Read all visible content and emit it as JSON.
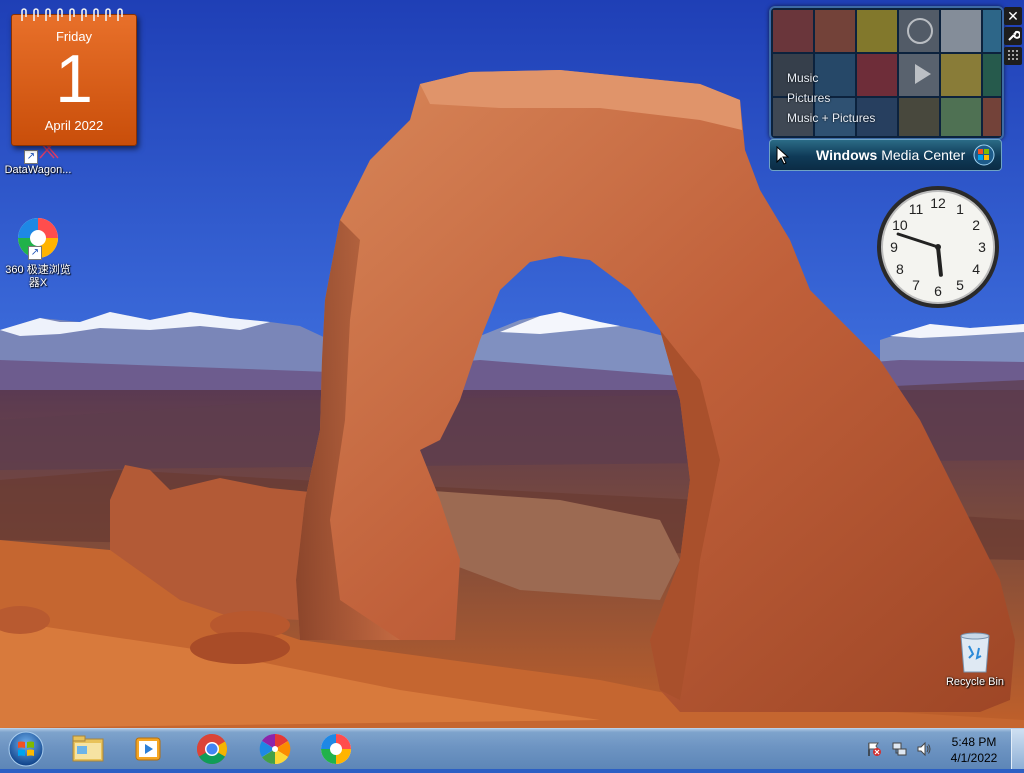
{
  "desktop": {
    "wallpaper": "delicate-arch-landscape",
    "icons": [
      {
        "label": "DataWagon...",
        "icon": "datawagon-icon"
      },
      {
        "label": "360 极速浏览器X",
        "label_line1": "360 极速浏览",
        "label_line2": "器X",
        "icon": "360-browser-icon"
      },
      {
        "label": "Recycle Bin",
        "icon": "recycle-bin-icon"
      }
    ]
  },
  "calendar_gadget": {
    "day_name": "Friday",
    "day_number": "1",
    "month_year": "April 2022",
    "color": "#d95c14"
  },
  "media_center_gadget": {
    "menu": [
      "Music",
      "Pictures",
      "Music + Pictures"
    ],
    "title_bold": "Windows",
    "title_rest": " Media Center"
  },
  "clock_gadget": {
    "numbers": [
      "12",
      "1",
      "2",
      "3",
      "4",
      "5",
      "6",
      "7",
      "8",
      "9",
      "10",
      "11"
    ],
    "hour": 5,
    "minute": 48
  },
  "taskbar": {
    "pinned": [
      {
        "name": "file-explorer",
        "icon": "folder-icon"
      },
      {
        "name": "media-player",
        "icon": "media-player-icon"
      },
      {
        "name": "chrome",
        "icon": "chrome-icon"
      },
      {
        "name": "pinwheel-app",
        "icon": "pinwheel-icon"
      },
      {
        "name": "360-browser",
        "icon": "360-browser-icon"
      }
    ],
    "tray": {
      "time": "5:48 PM",
      "date": "4/1/2022"
    },
    "colors": {
      "taskbar": "#6d94c2",
      "accent": "#1e5fb0"
    }
  }
}
